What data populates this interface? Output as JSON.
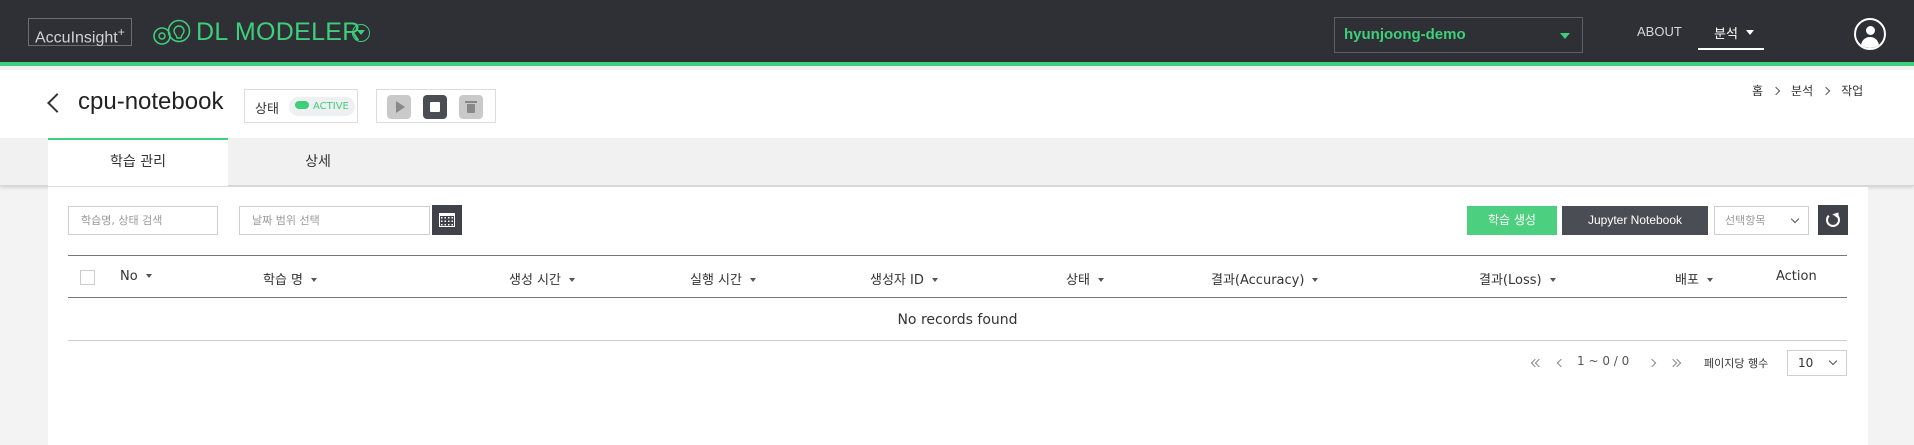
{
  "topbar": {
    "brand": "AccuInsight",
    "brand_suffix": "+",
    "product": "DL MODELER",
    "project": "hyunjoong-demo",
    "nav_about": "ABOUT",
    "nav_analysis": "분석"
  },
  "header": {
    "title": "cpu-notebook",
    "status_label": "상태",
    "status_value": "ACTIVE",
    "breadcrumb": [
      "홈",
      "분석",
      "작업"
    ]
  },
  "tabs": [
    "학습 관리",
    "상세"
  ],
  "toolbar": {
    "search_placeholder": "학습명, 상태 검색",
    "date_placeholder": "날짜 범위 선택",
    "create_label": "학습 생성",
    "jupyter_label": "Jupyter Notebook",
    "select_placeholder": "선택항목"
  },
  "table": {
    "columns": [
      "No",
      "학습 명",
      "생성 시간",
      "실행 시간",
      "생성자 ID",
      "상태",
      "결과(Accuracy)",
      "결과(Loss)",
      "배포",
      "Action"
    ],
    "empty_text": "No records found"
  },
  "pagination": {
    "range": "1 ~ 0 / 0",
    "rows_label": "페이지당 행수",
    "rows_value": "10"
  },
  "colors": {
    "accent": "#3ecf7a",
    "topbar": "#2e3035",
    "dark_button": "#4a4d54"
  }
}
